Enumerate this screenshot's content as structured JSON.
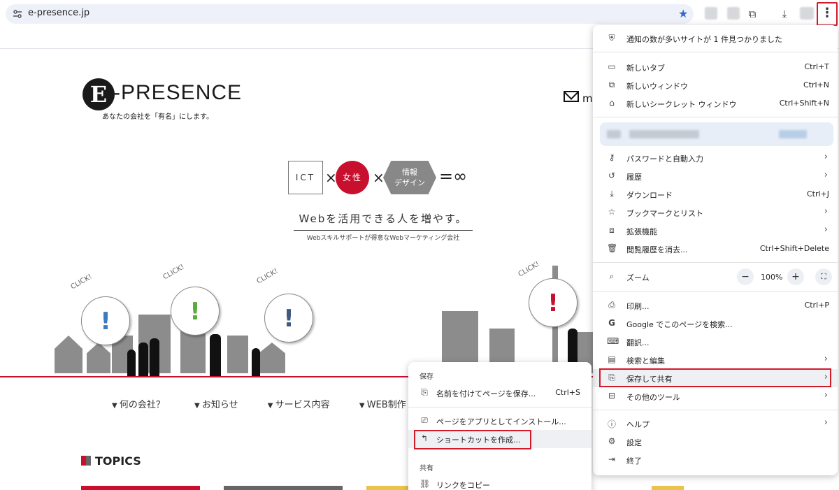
{
  "browser": {
    "url": "e-presence.jp",
    "menu_button_label": "⋮"
  },
  "site": {
    "logo_letter": "E",
    "logo_text": "-PRESENCE",
    "tagline": "あなたの会社を「有名」にします。",
    "mail_text": "m",
    "hero_ict": "ICT",
    "hero_times": "×",
    "hero_woman": "女性",
    "hero_info_line1": "情報",
    "hero_info_line2": "デザイン",
    "hero_eq": "=∞",
    "headline": "Webを活用できる人を増やす。",
    "subheadline": "Webスキルサポートが得意なWebマーケティング会社",
    "click_label": "CLICK!",
    "exclaim": "!",
    "nav": [
      "何の会社？",
      "お知らせ",
      "サービス内容",
      "WEB制作"
    ],
    "topics": "TOPICS"
  },
  "menu": {
    "notice": "通知の数が多いサイトが 1 件見つかりました",
    "new_tab": "新しいタブ",
    "new_tab_sc": "Ctrl+T",
    "new_window": "新しいウィンドウ",
    "new_window_sc": "Ctrl+N",
    "incognito": "新しいシークレット ウィンドウ",
    "incognito_sc": "Ctrl+Shift+N",
    "passwords": "パスワードと自動入力",
    "history": "履歴",
    "downloads": "ダウンロード",
    "downloads_sc": "Ctrl+J",
    "bookmarks": "ブックマークとリスト",
    "extensions": "拡張機能",
    "clear": "閲覧履歴を消去...",
    "clear_sc": "Ctrl+Shift+Delete",
    "zoom": "ズーム",
    "zoom_minus": "−",
    "zoom_value": "100%",
    "zoom_plus": "+",
    "print": "印刷...",
    "print_sc": "Ctrl+P",
    "google_search": "Google でこのページを検索...",
    "translate": "翻訳...",
    "search_edit": "検索と編集",
    "save_share": "保存して共有",
    "other_tools": "その他のツール",
    "help": "ヘルプ",
    "settings": "設定",
    "exit": "終了",
    "arrow": "›"
  },
  "submenu": {
    "save_header": "保存",
    "save_as": "名前を付けてページを保存...",
    "save_as_sc": "Ctrl+S",
    "install": "ページをアプリとしてインストール...",
    "shortcut": "ショートカットを作成...",
    "share_header": "共有",
    "copy_link": "リンクをコピー"
  }
}
